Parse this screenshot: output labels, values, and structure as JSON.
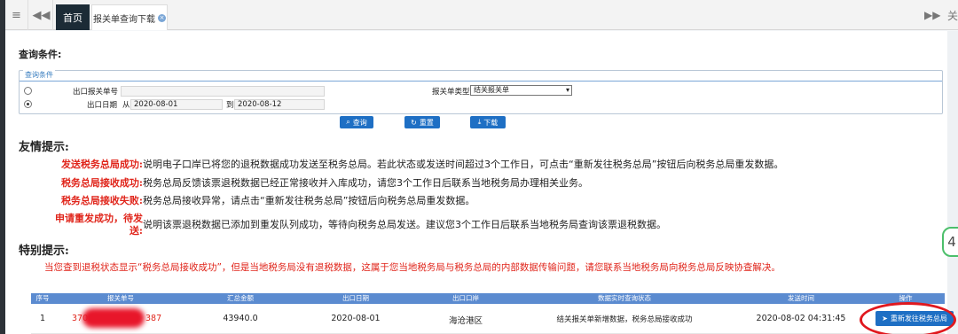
{
  "tabs": {
    "home": "首页",
    "active": "报关单查询下载",
    "close_symbol": "×",
    "right_label": "关"
  },
  "query": {
    "title": "查询条件:",
    "legend": "查询条件",
    "export_no_label": "出口报关单号",
    "export_date_label": "出口日期",
    "from_label": "从",
    "from_value": "2020-08-01",
    "to_label": "到",
    "to_value": "2020-08-12",
    "type_label": "报关单类型",
    "type_value": "结关报关单",
    "buttons": {
      "search": "查询",
      "reset": "重置",
      "download": "下载"
    }
  },
  "friendly": {
    "heading": "友情提示:",
    "tips": [
      {
        "key": "发送税务总局成功:",
        "text": "说明电子口岸已将您的退税数据成功发送至税务总局。若此状态或发送时间超过3个工作日，可点击“重新发往税务总局”按钮后向税务总局重发数据。"
      },
      {
        "key": "税务总局接收成功:",
        "text": "税务总局反馈该票退税数据已经正常接收并入库成功，请您3个工作日后联系当地税务局办理相关业务。"
      },
      {
        "key": "税务总局接收失败:",
        "text": "税务总局接收异常，请点击“重新发往税务总局”按钮后向税务总局重发数据。"
      },
      {
        "key_line1": "申请重发成功，待发",
        "key_line2": "送:",
        "text": "说明该票退税数据已添加到重发队列成功，等待向税务总局发送。建议您3个工作日后联系当地税务局查询该票退税数据。"
      }
    ]
  },
  "special": {
    "heading": "特别提示:",
    "text": "当您查到退税状态显示“税务总局接收成功”，但是当地税务局没有退税数据，这属于您当地税务局与税务总局的内部数据传输问题，请您联系当地税务局向税务总局反映协查解决。"
  },
  "table": {
    "headers": [
      "序号",
      "报关单号",
      "汇总金额",
      "出口日期",
      "出口口岸",
      "数据实时查询状态",
      "发送时间",
      "操作"
    ],
    "rows": [
      {
        "index": "1",
        "no_prefix": "370",
        "no_suffix": "387",
        "amount": "43940.0",
        "export_date": "2020-08-01",
        "port": "海沧港区",
        "status": "结关报关单新增数据，税务总局接收成功",
        "sent_time": "2020-08-02 04:31:45",
        "action": "重新发往税务总局"
      }
    ]
  },
  "float_badge": "4",
  "colors": {
    "accent": "#1e6fc4",
    "warning": "#e0251b",
    "header": "#5b8bd0",
    "dark_tab": "#1c2b36"
  }
}
